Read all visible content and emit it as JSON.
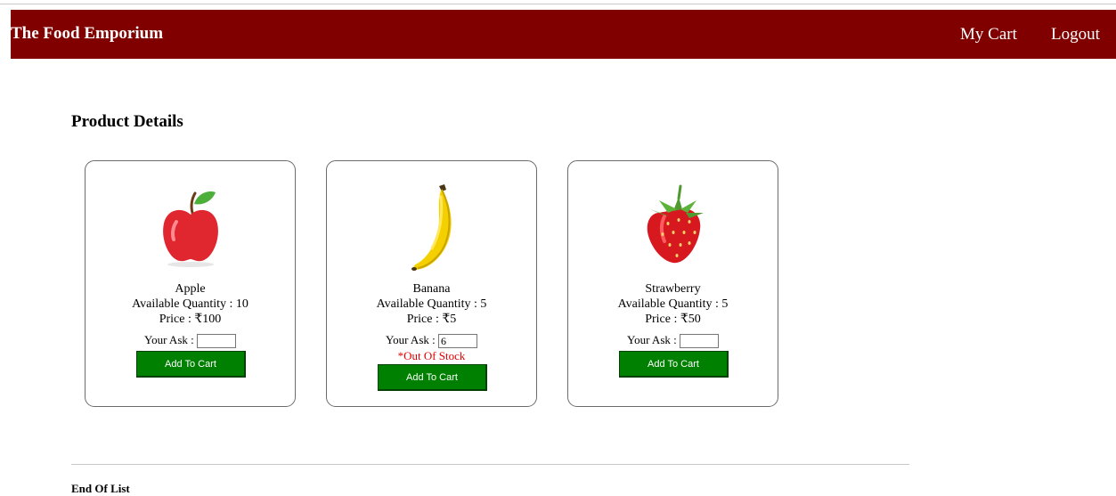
{
  "header": {
    "brand": "The Food Emporium",
    "nav": [
      {
        "label": "My Cart"
      },
      {
        "label": "Logout"
      }
    ]
  },
  "page_title": "Product Details",
  "products": [
    {
      "name": "Apple",
      "quantity_text": "Available Quantity : 10",
      "price_text": "Price : ₹100",
      "ask_label": "Your Ask :",
      "ask_value": "",
      "stock_message": "",
      "button_label": "Add To Cart",
      "icon": "apple-icon"
    },
    {
      "name": "Banana",
      "quantity_text": "Available Quantity : 5",
      "price_text": "Price : ₹5",
      "ask_label": "Your Ask :",
      "ask_value": "6",
      "stock_message": "*Out Of Stock",
      "button_label": "Add To Cart",
      "icon": "banana-icon"
    },
    {
      "name": "Strawberry",
      "quantity_text": "Available Quantity : 5",
      "price_text": "Price : ₹50",
      "ask_label": "Your Ask :",
      "ask_value": "",
      "stock_message": "",
      "button_label": "Add To Cart",
      "icon": "strawberry-icon"
    }
  ],
  "footer": {
    "text": "End Of List"
  },
  "colors": {
    "header_bg": "#800000",
    "button_bg": "#008000",
    "error_text": "#e00000"
  }
}
